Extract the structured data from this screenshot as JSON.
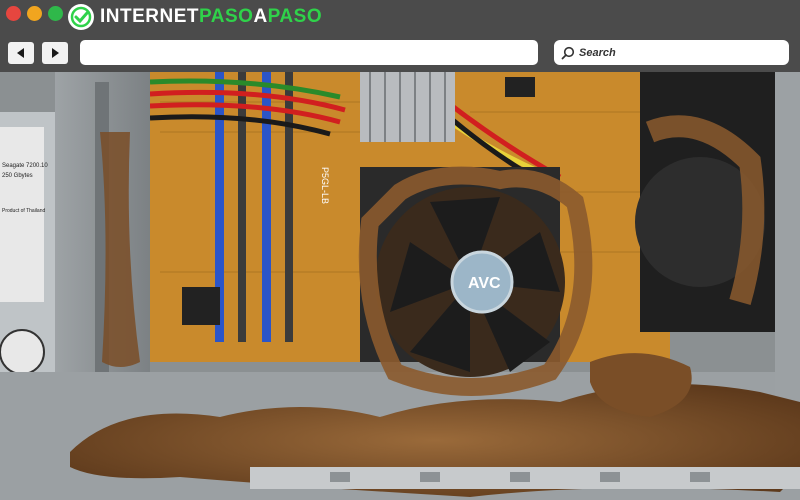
{
  "window": {
    "brand": {
      "part1": "INTERNET",
      "part2": "PASO",
      "part3": "A",
      "part4": "PASO"
    }
  },
  "nav": {
    "back_icon": "triangle-left-icon",
    "forward_icon": "triangle-right-icon",
    "url_value": ""
  },
  "search": {
    "label": "Search",
    "icon": "magnifier-icon"
  },
  "photo": {
    "fan_label": "AVC",
    "board_label": "P5GL-LB",
    "drive_label_1": "Seagate 7200.10",
    "drive_label_2": "250 Gbytes",
    "drive_label_3": "Product of Thailand"
  },
  "colors": {
    "traffic_red": "#e6463f",
    "traffic_yellow": "#f1a51f",
    "traffic_green": "#2fb84a",
    "brand_green": "#2fd24a",
    "dust": "#8a5a30",
    "board": "#c98a2c"
  }
}
